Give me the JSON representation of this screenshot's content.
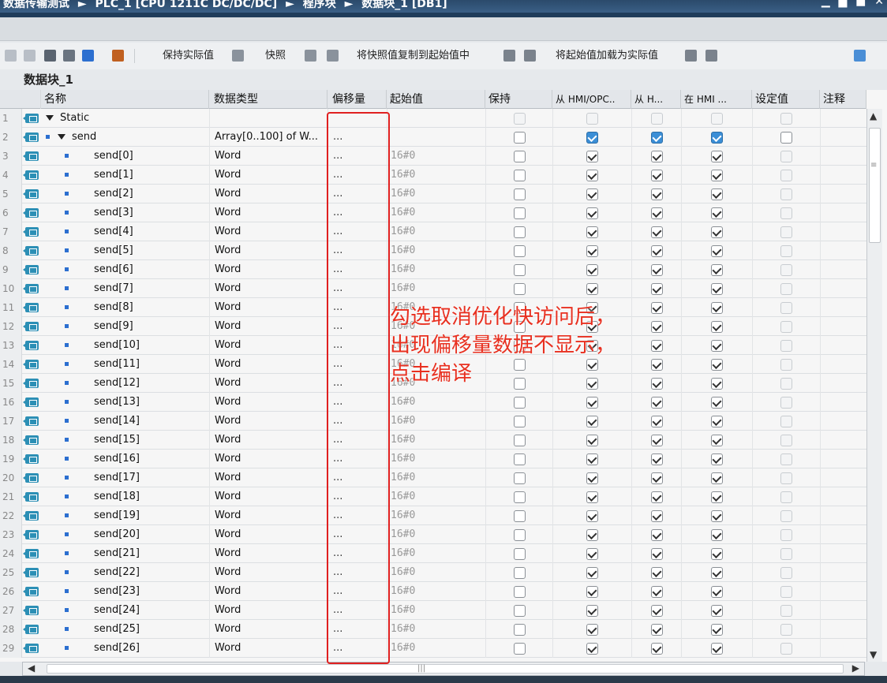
{
  "title": {
    "crumbs": [
      "数据传输测试",
      "►",
      "PLC_1 [CPU 1211C DC/DC/DC]",
      "►",
      "程序块",
      "►",
      "数据块_1 [DB1]"
    ],
    "controls": [
      "▁",
      "▇",
      "■",
      "✕"
    ]
  },
  "toolbar": {
    "keep_actual": "保持实际值",
    "snapshot": "快照",
    "copy_snapshot": "将快照值复制到起始值中",
    "load_start": "将起始值加载为实际值"
  },
  "db_name": "数据块_1",
  "columns": {
    "name": "名称",
    "type": "数据类型",
    "offset": "偏移量",
    "start": "起始值",
    "retain": "保持",
    "hmi_from": "从 HMI/OPC..",
    "hmi_from2": "从 H...",
    "hmi_in": "在 HMI ...",
    "setpoint": "设定值",
    "comment": "注释"
  },
  "rows": [
    {
      "num": "1",
      "name": "Static",
      "type": "",
      "offset": "",
      "start": ""
    },
    {
      "num": "2",
      "name": "send",
      "type": "Array[0..100] of W...",
      "offset": "...",
      "start": ""
    },
    {
      "num": "3",
      "name": "send[0]",
      "type": "Word",
      "offset": "...",
      "start": "16#0"
    },
    {
      "num": "4",
      "name": "send[1]",
      "type": "Word",
      "offset": "...",
      "start": "16#0"
    },
    {
      "num": "5",
      "name": "send[2]",
      "type": "Word",
      "offset": "...",
      "start": "16#0"
    },
    {
      "num": "6",
      "name": "send[3]",
      "type": "Word",
      "offset": "...",
      "start": "16#0"
    },
    {
      "num": "7",
      "name": "send[4]",
      "type": "Word",
      "offset": "...",
      "start": "16#0"
    },
    {
      "num": "8",
      "name": "send[5]",
      "type": "Word",
      "offset": "...",
      "start": "16#0"
    },
    {
      "num": "9",
      "name": "send[6]",
      "type": "Word",
      "offset": "...",
      "start": "16#0"
    },
    {
      "num": "10",
      "name": "send[7]",
      "type": "Word",
      "offset": "...",
      "start": "16#0"
    },
    {
      "num": "11",
      "name": "send[8]",
      "type": "Word",
      "offset": "...",
      "start": "16#0"
    },
    {
      "num": "12",
      "name": "send[9]",
      "type": "Word",
      "offset": "...",
      "start": "16#0"
    },
    {
      "num": "13",
      "name": "send[10]",
      "type": "Word",
      "offset": "...",
      "start": "16#0"
    },
    {
      "num": "14",
      "name": "send[11]",
      "type": "Word",
      "offset": "...",
      "start": "16#0"
    },
    {
      "num": "15",
      "name": "send[12]",
      "type": "Word",
      "offset": "...",
      "start": "16#0"
    },
    {
      "num": "16",
      "name": "send[13]",
      "type": "Word",
      "offset": "...",
      "start": "16#0"
    },
    {
      "num": "17",
      "name": "send[14]",
      "type": "Word",
      "offset": "...",
      "start": "16#0"
    },
    {
      "num": "18",
      "name": "send[15]",
      "type": "Word",
      "offset": "...",
      "start": "16#0"
    },
    {
      "num": "19",
      "name": "send[16]",
      "type": "Word",
      "offset": "...",
      "start": "16#0"
    },
    {
      "num": "20",
      "name": "send[17]",
      "type": "Word",
      "offset": "...",
      "start": "16#0"
    },
    {
      "num": "21",
      "name": "send[18]",
      "type": "Word",
      "offset": "...",
      "start": "16#0"
    },
    {
      "num": "22",
      "name": "send[19]",
      "type": "Word",
      "offset": "...",
      "start": "16#0"
    },
    {
      "num": "23",
      "name": "send[20]",
      "type": "Word",
      "offset": "...",
      "start": "16#0"
    },
    {
      "num": "24",
      "name": "send[21]",
      "type": "Word",
      "offset": "...",
      "start": "16#0"
    },
    {
      "num": "25",
      "name": "send[22]",
      "type": "Word",
      "offset": "...",
      "start": "16#0"
    },
    {
      "num": "26",
      "name": "send[23]",
      "type": "Word",
      "offset": "...",
      "start": "16#0"
    },
    {
      "num": "27",
      "name": "send[24]",
      "type": "Word",
      "offset": "...",
      "start": "16#0"
    },
    {
      "num": "28",
      "name": "send[25]",
      "type": "Word",
      "offset": "...",
      "start": "16#0"
    },
    {
      "num": "29",
      "name": "send[26]",
      "type": "Word",
      "offset": "...",
      "start": "16#0"
    }
  ],
  "annotation": {
    "line1": "勾选取消优化快访问后，",
    "line2": "出现偏移量数据不显示，",
    "line3": "点击编译"
  },
  "colors": {
    "annotation": "#e83020",
    "db_icon": "#2c8fb5",
    "title_bar": "#2b4a6b"
  }
}
